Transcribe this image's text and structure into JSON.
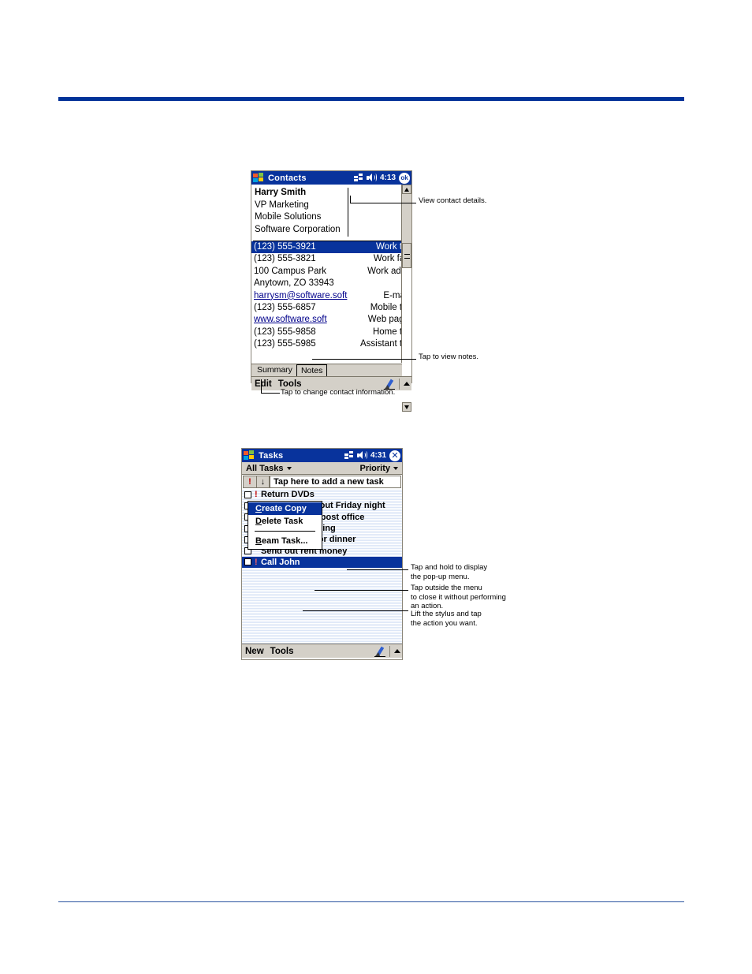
{
  "page": {
    "rule_color": "#003399"
  },
  "contacts": {
    "titlebar": {
      "title": "Contacts",
      "clock": "4:13",
      "ok_label": "ok",
      "connect_icon": "connectivity-icon",
      "speaker_icon": "speaker-icon"
    },
    "header": {
      "name": "Harry Smith",
      "job_title": "VP Marketing",
      "department": "Mobile Solutions",
      "company": "Software Corporation"
    },
    "rows": [
      {
        "value": "(123) 555-3921",
        "label": "Work tel",
        "selected": true,
        "link": false
      },
      {
        "value": "(123) 555-3821",
        "label": "Work fax",
        "selected": false,
        "link": false
      },
      {
        "value": "100 Campus Park",
        "label": "Work addr",
        "selected": false,
        "link": false
      },
      {
        "value": "Anytown, ZO 33943",
        "label": "",
        "selected": false,
        "link": false
      },
      {
        "value": "harrysm@software.soft",
        "label": "E-mail",
        "selected": false,
        "link": true
      },
      {
        "value": "(123) 555-6857",
        "label": "Mobile tel",
        "selected": false,
        "link": false
      },
      {
        "value": "www.software.soft",
        "label": "Web page",
        "selected": false,
        "link": true
      },
      {
        "value": "(123) 555-9858",
        "label": "Home tel",
        "selected": false,
        "link": false
      },
      {
        "value": "(123) 555-5985",
        "label": "Assistant tel",
        "selected": false,
        "link": false
      }
    ],
    "tabs": [
      {
        "label": "Summary",
        "active": false
      },
      {
        "label": "Notes",
        "active": true
      }
    ],
    "commandbar": {
      "edit_label": "Edit",
      "tools_label": "Tools",
      "pen_icon": "pen-icon",
      "arrow_icon": "arrow-up-icon"
    },
    "annotations": {
      "view_details": "View contact details.",
      "view_notes": "Tap to view notes.",
      "change_info": "Tap to change contact information."
    }
  },
  "tasks": {
    "titlebar": {
      "title": "Tasks",
      "clock": "4:31",
      "close_label": "✕",
      "connect_icon": "connectivity-icon",
      "speaker_icon": "speaker-icon"
    },
    "toolbar": {
      "filter_label": "All Tasks",
      "sort_label": "Priority"
    },
    "newtask": {
      "priority_btn": "!",
      "sort_btn": "↓",
      "placeholder": "Tap here to add a new task"
    },
    "items": [
      {
        "label": "Return DVDs",
        "priority": "!",
        "selected": false,
        "checked": false
      },
      {
        "label": "Call Stacey about Friday night",
        "priority": "",
        "selected": false,
        "checked": false
      },
      {
        "label": "Get stamps at post office",
        "priority": "",
        "selected": false,
        "checked": false
      },
      {
        "label": "Grocery shopping",
        "priority": "",
        "selected": false,
        "checked": false
      },
      {
        "label": "Pick up food for dinner",
        "priority": "",
        "selected": false,
        "checked": false
      },
      {
        "label": "Send out rent money",
        "priority": "",
        "selected": false,
        "checked": false
      },
      {
        "label": "Call John",
        "priority": "!",
        "selected": true,
        "checked": false
      }
    ],
    "context_menu": [
      {
        "label": "Create Copy",
        "active": true
      },
      {
        "label": "Delete Task",
        "active": false
      },
      {
        "separator": true
      },
      {
        "label": "Beam Task...",
        "active": false
      }
    ],
    "commandbar": {
      "new_label": "New",
      "tools_label": "Tools",
      "pen_icon": "pen-icon",
      "arrow_icon": "arrow-up-icon"
    },
    "annotations": {
      "tap_hold": "Tap and hold to display\nthe pop-up menu.",
      "tap_outside": "Tap outside the menu\nto close it without performing\nan action.",
      "lift_stylus": "Lift the stylus and tap\nthe action you want."
    }
  }
}
